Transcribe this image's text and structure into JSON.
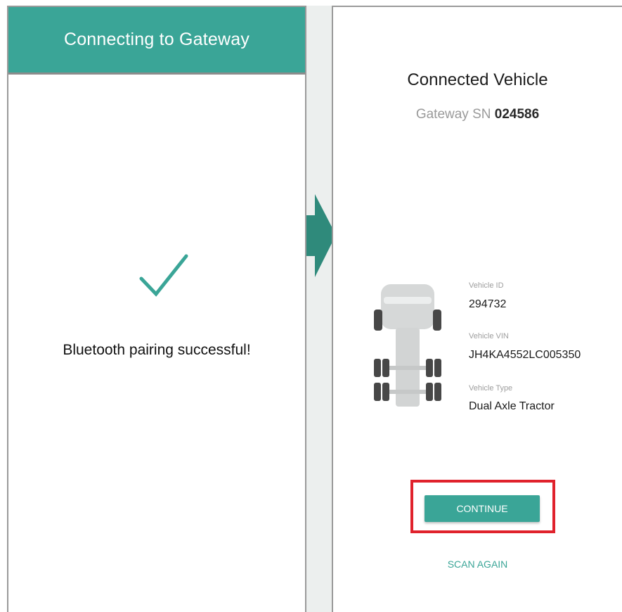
{
  "left_screen": {
    "appbar_title": "Connecting to Gateway",
    "icon": "check-icon",
    "message": "Bluetooth pairing successful!"
  },
  "right_screen": {
    "title": "Connected Vehicle",
    "gateway_sn_label": "Gateway SN",
    "gateway_sn_value": "024586",
    "vehicle_icon": "truck-top-view-icon",
    "fields": {
      "vehicle_id_label": "Vehicle ID",
      "vehicle_id_value": "294732",
      "vehicle_vin_label": "Vehicle VIN",
      "vehicle_vin_value": "JH4KA4552LC005350",
      "vehicle_type_label": "Vehicle Type",
      "vehicle_type_value": "Dual Axle Tractor"
    },
    "continue_label": "CONTINUE",
    "scan_again_label": "SCAN AGAIN"
  },
  "colors": {
    "accent": "#3aa597",
    "highlight": "#e0222c",
    "arrow": "#2f8a7b"
  }
}
